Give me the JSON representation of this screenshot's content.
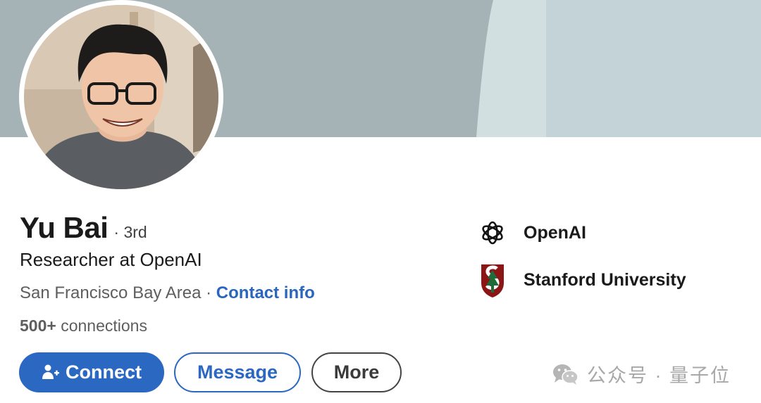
{
  "profile": {
    "name": "Yu Bai",
    "degree": "· 3rd",
    "headline": "Researcher at OpenAI",
    "location": "San Francisco Bay Area",
    "separator": " · ",
    "contact_label": "Contact info",
    "connections_count": "500+",
    "connections_label": " connections"
  },
  "actions": {
    "connect_label": "Connect",
    "message_label": "Message",
    "more_label": "More"
  },
  "organizations": [
    {
      "name": "OpenAI",
      "icon": "openai-logo"
    },
    {
      "name": "Stanford University",
      "icon": "stanford-logo"
    }
  ],
  "watermark": {
    "text": "公众号 · 量子位",
    "icon": "wechat-icon"
  },
  "colors": {
    "accent": "#2b68c2",
    "cover": "#a5b3b7",
    "stanford": "#8c1515"
  }
}
